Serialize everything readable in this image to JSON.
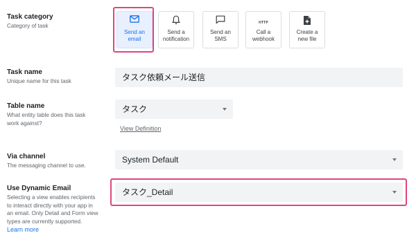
{
  "task_category": {
    "title": "Task category",
    "description": "Category of task",
    "options": [
      {
        "label_line1": "Send an",
        "label_line2": "email",
        "icon": "mail-icon",
        "selected": true
      },
      {
        "label_line1": "Send a",
        "label_line2": "notification",
        "icon": "bell-icon",
        "selected": false
      },
      {
        "label_line1": "Send an",
        "label_line2": "SMS",
        "icon": "chat-bubble-icon",
        "selected": false
      },
      {
        "label_line1": "Call a",
        "label_line2": "webhook",
        "icon": "http-icon",
        "icon_text": "HTTP",
        "selected": false
      },
      {
        "label_line1": "Create a",
        "label_line2": "new file",
        "icon": "new-file-icon",
        "selected": false
      }
    ]
  },
  "task_name": {
    "title": "Task name",
    "description": "Unique name for this task",
    "value": "タスク依頼メール送信"
  },
  "table_name": {
    "title": "Table name",
    "description_line1": "What entity table does this task",
    "description_line2": "work against?",
    "value": "タスク",
    "link": "View Definition"
  },
  "via_channel": {
    "title": "Via channel",
    "description": "The messaging channel to use.",
    "value": "System Default"
  },
  "dynamic_email": {
    "title": "Use Dynamic Email",
    "description_lines": [
      "Selecting a view enables recipients",
      "to interact directly with your app in",
      "an email. Only Detail and Form view",
      "types are currently supported."
    ],
    "link": "Learn more",
    "value": "タスク_Detail"
  },
  "colors": {
    "accent": "#1a73e8",
    "highlight": "#e0457b",
    "field_bg": "#f1f3f4",
    "selected_tile_bg": "#e8f0fe"
  }
}
